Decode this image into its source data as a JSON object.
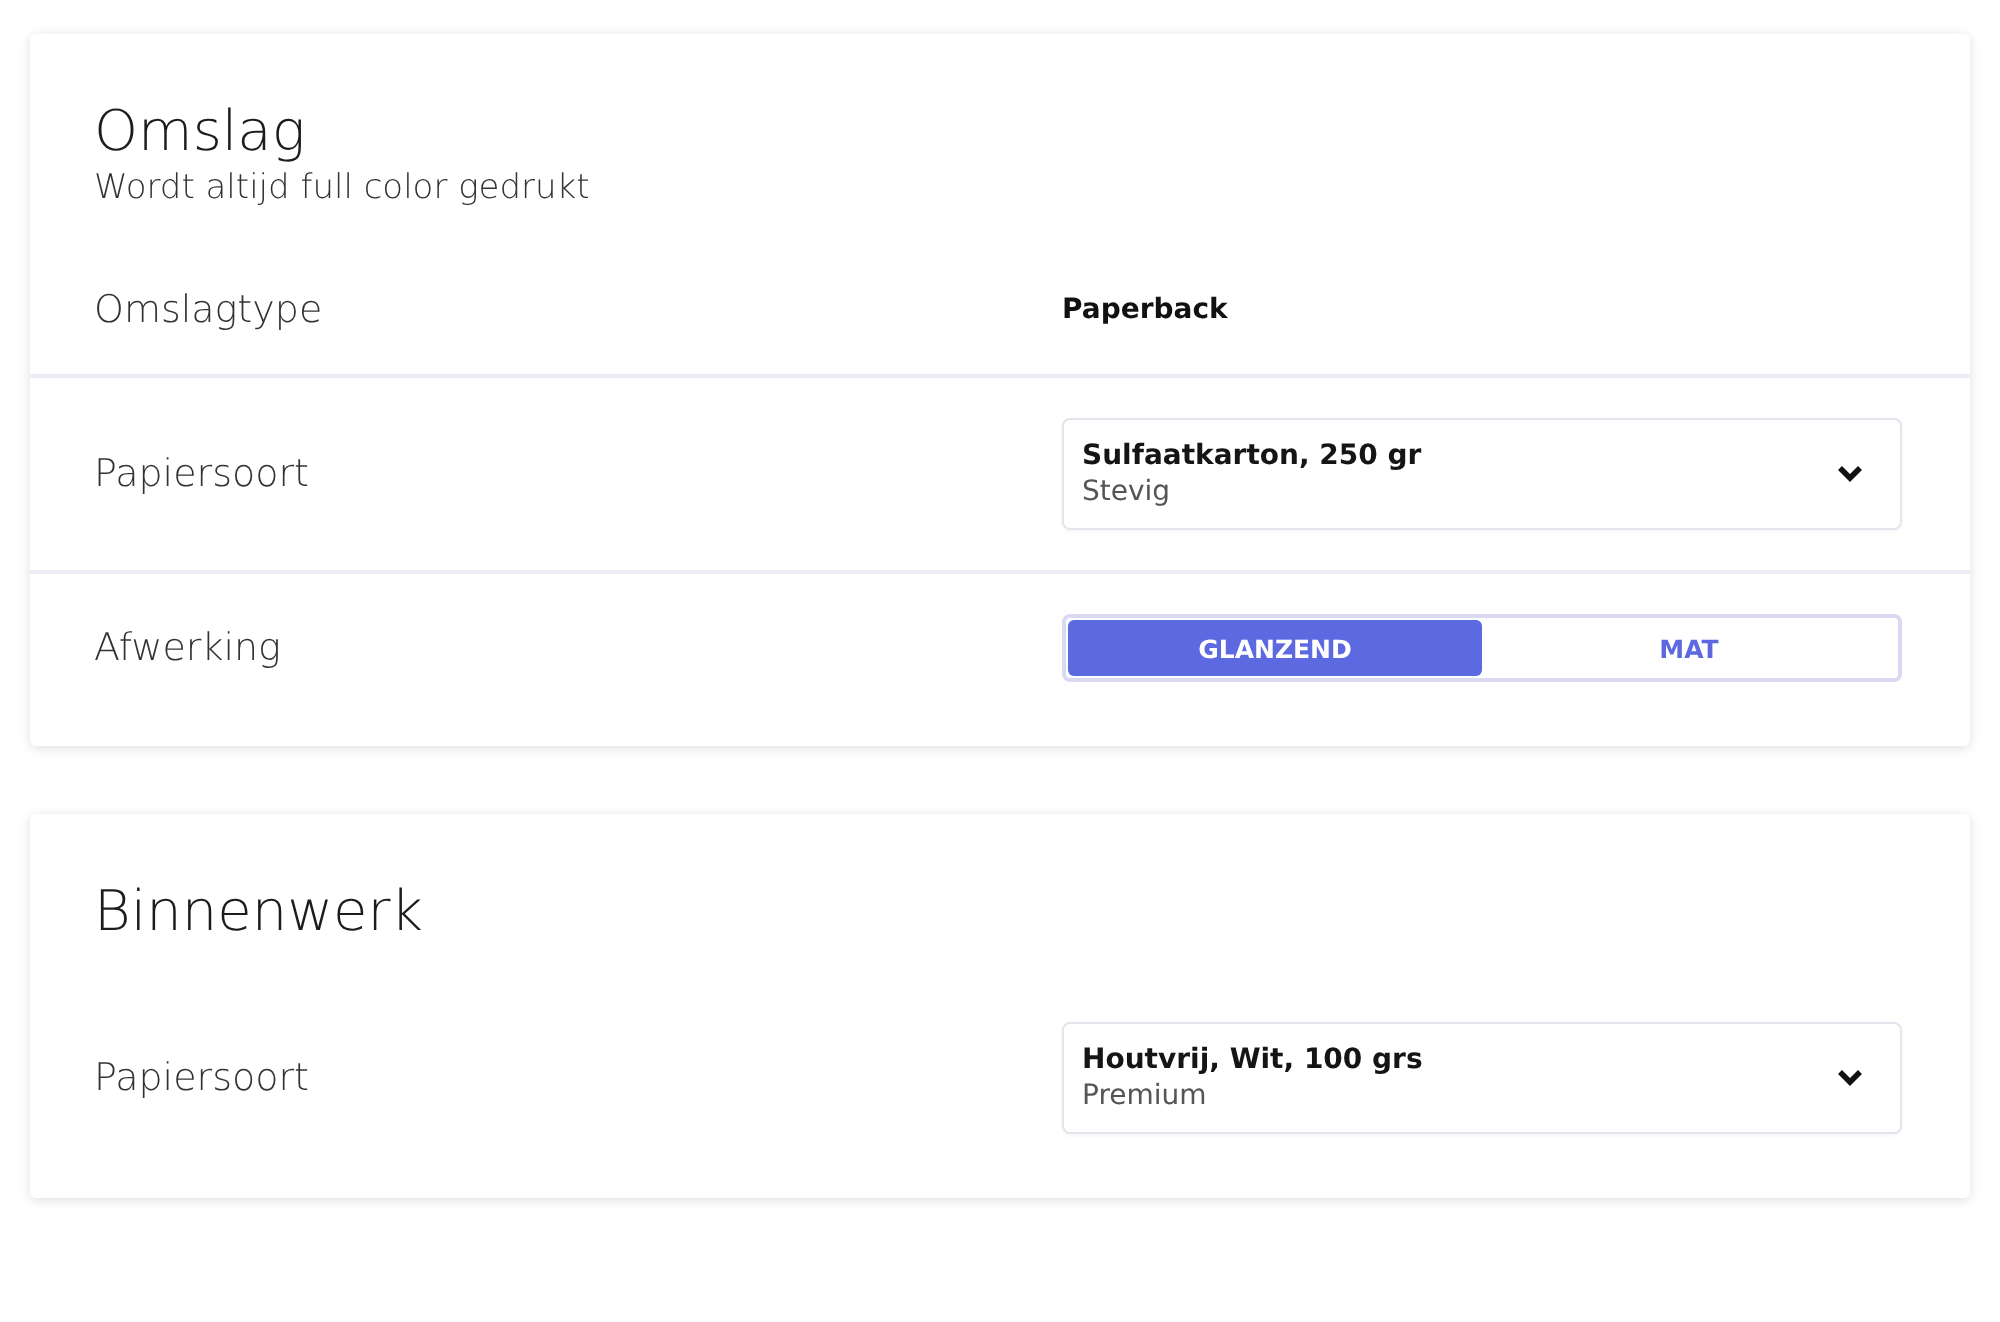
{
  "sections": [
    {
      "title": "Omslag",
      "subtitle": "Wordt altijd full color gedrukt",
      "rows": [
        {
          "kind": "text",
          "label": "Omslagtype",
          "value": "Paperback"
        },
        {
          "kind": "select",
          "label": "Papiersoort",
          "value": "Sulfaatkarton, 250 gr",
          "detail": "Stevig"
        },
        {
          "kind": "toggle",
          "label": "Afwerking",
          "options": [
            {
              "label": "GLANZEND",
              "selected": true
            },
            {
              "label": "MAT",
              "selected": false
            }
          ]
        }
      ]
    },
    {
      "title": "Binnenwerk",
      "rows": [
        {
          "kind": "select",
          "label": "Papiersoort",
          "value": "Houtvrij, Wit, 100 grs",
          "detail": "Premium"
        }
      ]
    }
  ]
}
